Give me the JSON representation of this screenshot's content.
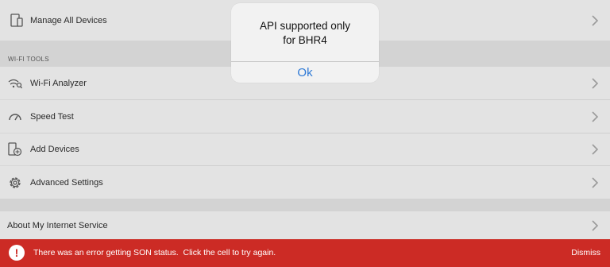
{
  "devices": {
    "manage_all_label": "Manage All Devices"
  },
  "wifi_tools": {
    "section_title": "WI-FI TOOLS",
    "items": [
      {
        "label": "Wi-Fi Analyzer",
        "icon": "wifi-search-icon"
      },
      {
        "label": "Speed Test",
        "icon": "speedometer-icon"
      },
      {
        "label": "Add Devices",
        "icon": "add-device-icon"
      },
      {
        "label": "Advanced Settings",
        "icon": "gear-icon"
      }
    ]
  },
  "about": {
    "label": "About My Internet Service"
  },
  "alert": {
    "message": "API supported only for BHR4",
    "ok_label": "Ok"
  },
  "error_banner": {
    "message": "There was an error getting SON status.  Click the cell to try again.",
    "dismiss_label": "Dismiss",
    "icon": "!"
  },
  "colors": {
    "banner": "#cc2b25",
    "link_blue": "#2f7ad6"
  }
}
